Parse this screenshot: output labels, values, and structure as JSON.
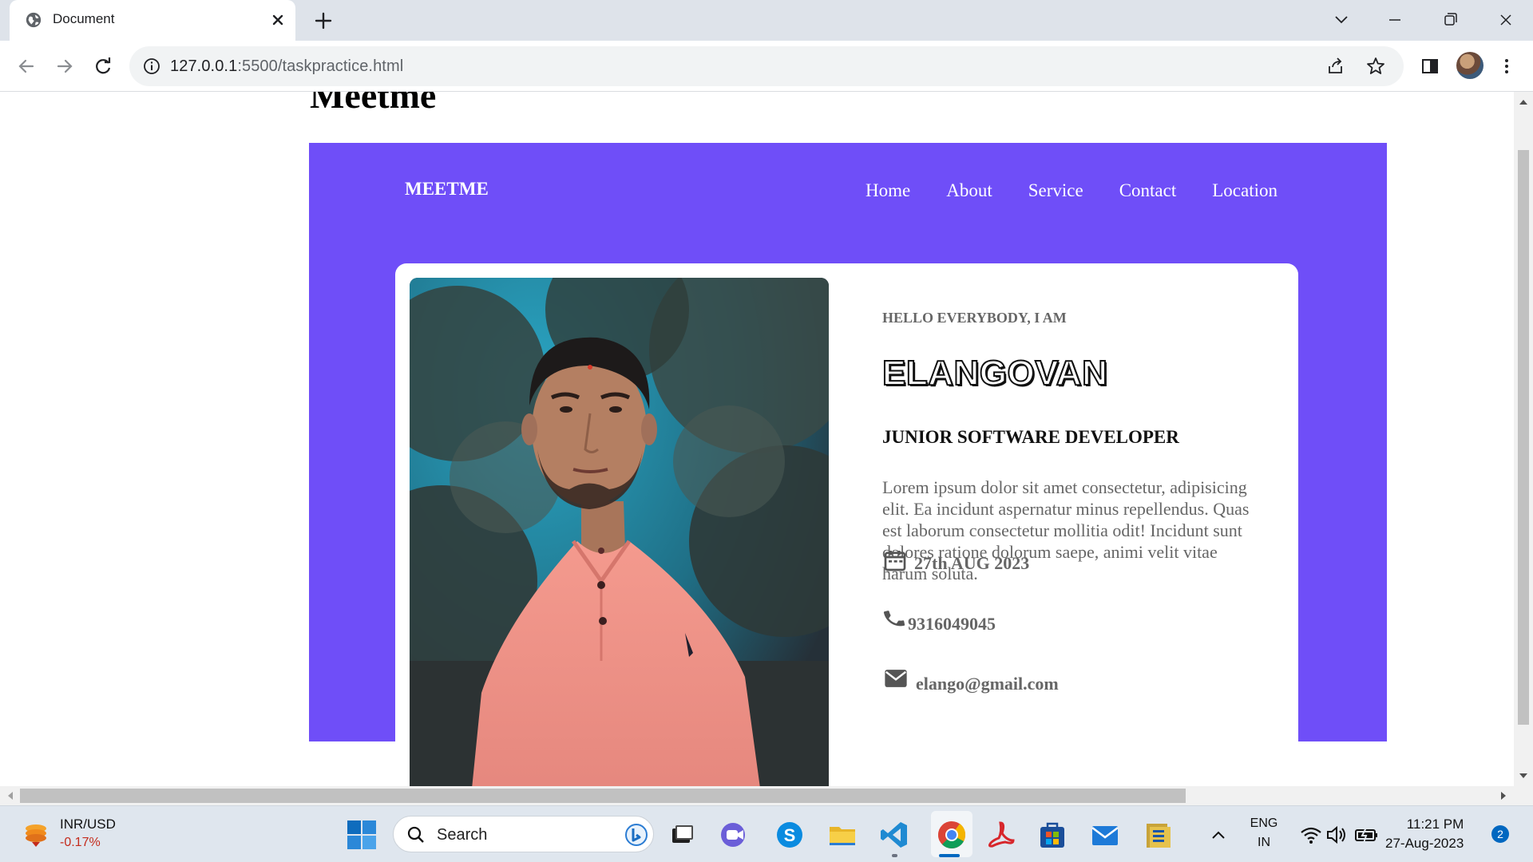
{
  "browser": {
    "tab_title": "Document",
    "url_host": "127.0.0.1",
    "url_path": ":5500/taskpractice.html"
  },
  "page": {
    "heading": "Meetme",
    "brand": "MEETME",
    "nav": [
      "Home",
      "About",
      "Service",
      "Contact",
      "Location"
    ],
    "profile": {
      "greeting": "HELLO EVERYBODY, I AM",
      "name": "ELANGOVAN",
      "role": "JUNIOR SOFTWARE DEVELOPER",
      "bio": "Lorem ipsum dolor sit amet consectetur, adipisicing elit. Ea incidunt aspernatur minus repellendus. Quas est laborum consectetur mollitia odit! Incidunt sunt dolores ratione dolorum saepe, animi velit vitae harum soluta.",
      "date": "27th AUG 2023",
      "phone": "9316049045",
      "email": "elango@gmail.com"
    },
    "accent_color": "#6f4ef8"
  },
  "taskbar": {
    "stock_name": "INR/USD",
    "stock_change": "-0.17%",
    "search_label": "Search",
    "lang_top": "ENG",
    "lang_bottom": "IN",
    "time": "11:21 PM",
    "date": "27-Aug-2023",
    "notification_count": "2",
    "pinned": [
      "task-view-icon",
      "meet-icon",
      "skype-icon",
      "file-explorer-icon",
      "vscode-icon",
      "chrome-icon",
      "acrobat-icon",
      "store-icon",
      "mail-icon",
      "archive-icon"
    ]
  }
}
